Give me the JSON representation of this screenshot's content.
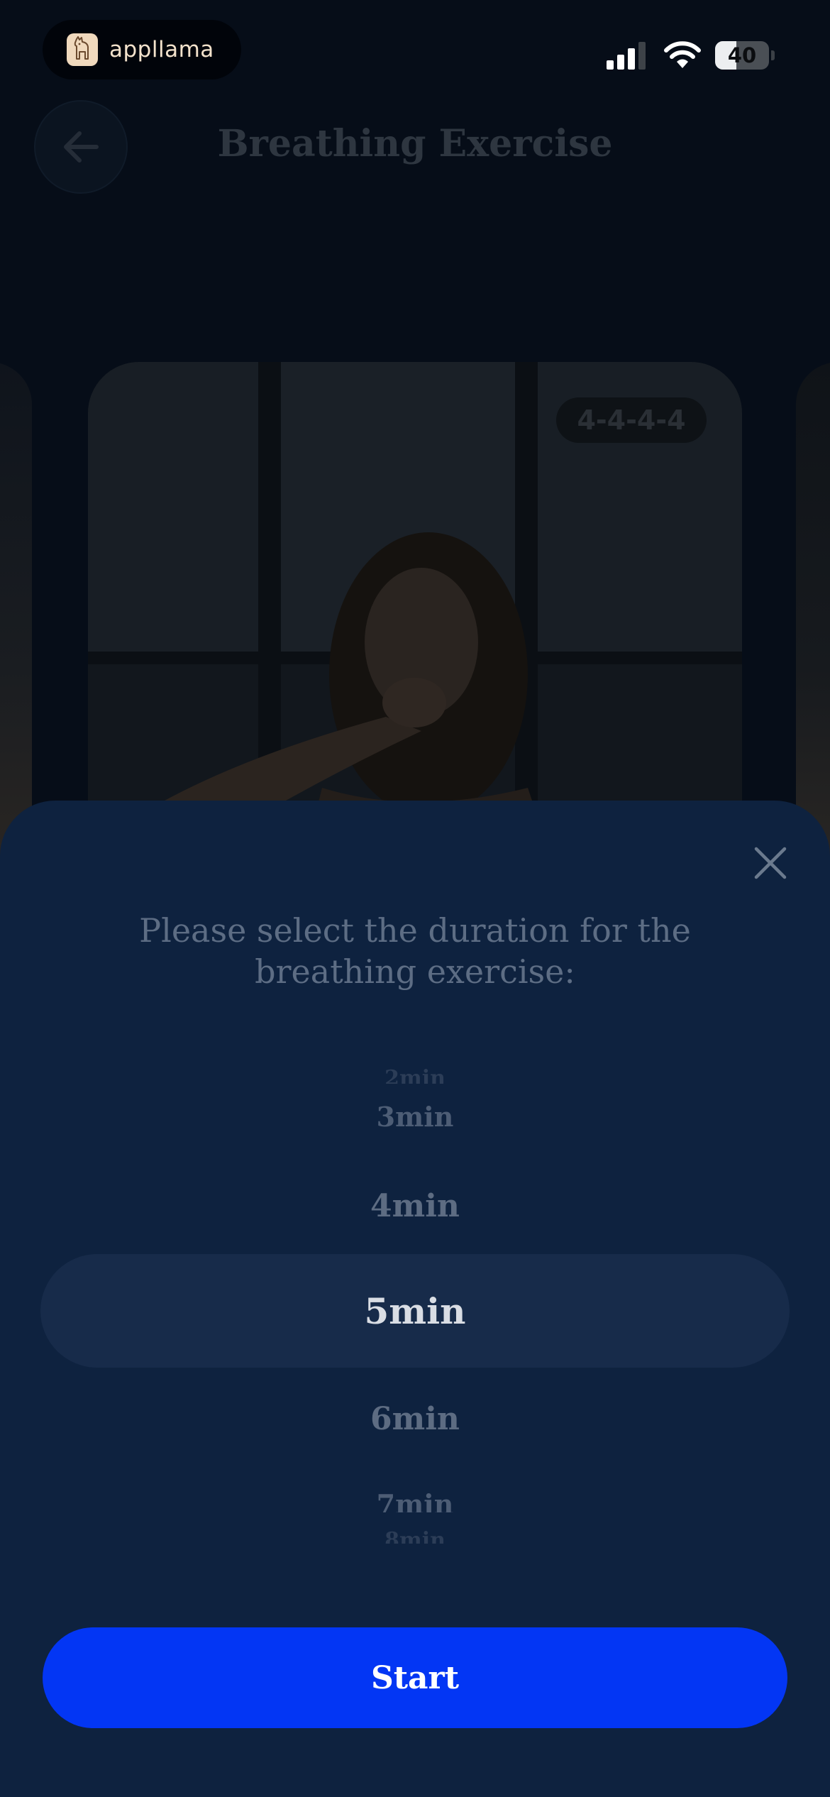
{
  "status_bar": {
    "app_name": "appllama",
    "app_icon": "llama-icon",
    "signal_icon": "cellular-signal-icon",
    "wifi_icon": "wifi-icon",
    "battery_level": 40,
    "battery_label": "40"
  },
  "header": {
    "back_icon": "arrow-left-icon",
    "title": "Breathing Exercise"
  },
  "exercise_card": {
    "pattern": "4-4-4-4"
  },
  "duration_sheet": {
    "close_icon": "close-icon",
    "prompt": "Please select the duration for the breathing exercise:",
    "options": [
      "2min",
      "3min",
      "4min",
      "5min",
      "6min",
      "7min",
      "8min"
    ],
    "selected": "5min",
    "start_label": "Start"
  },
  "colors": {
    "accent": "#0336f4",
    "sheet_background": "#0e223f",
    "picker_highlight": "#172b4a"
  }
}
